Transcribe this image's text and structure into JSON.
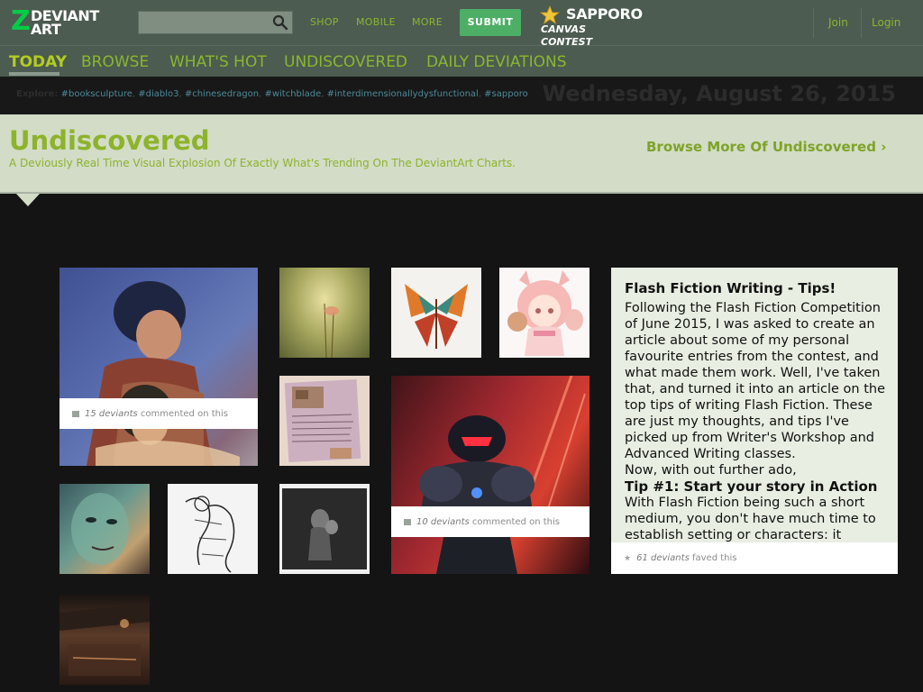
{
  "header": {
    "logo_mark": "Z",
    "logo_line1": "DEVIANT",
    "logo_line2": "ART",
    "search": {
      "value": "",
      "placeholder": ""
    },
    "nav": [
      "SHOP",
      "MOBILE",
      "MORE"
    ],
    "submit_label": "SUBMIT",
    "contest_line1": "SAPPORO",
    "contest_line2": "CANVAS CONTEST",
    "join_label": "Join",
    "login_label": "Login"
  },
  "tabs": [
    {
      "label": "TODAY",
      "active": true
    },
    {
      "label": "BROWSE",
      "active": false
    },
    {
      "label": "WHAT'S HOT",
      "active": false
    },
    {
      "label": "UNDISCOVERED",
      "active": false
    },
    {
      "label": "DAILY DEVIATIONS",
      "active": false
    }
  ],
  "explore": {
    "label": "Explore:",
    "tags": [
      "#booksculpture",
      "#diablo3",
      "#chinesedragon",
      "#witchblade",
      "#interdimensionallydysfunctional",
      "#sapporo"
    ]
  },
  "date": "Wednesday, August 26, 2015",
  "hero": {
    "title": "Undiscovered",
    "subtitle": "A Deviously Real Time Visual Explosion Of Exactly What's Trending On The DeviantArt Charts.",
    "browse_more": "Browse More Of Undiscovered",
    "browse_arrow": "›"
  },
  "tiles": [
    {
      "id": "figure-couple",
      "comment_count": "15 deviants",
      "comment_suffix": "commented on this"
    },
    {
      "id": "armored-robot",
      "comment_count": "10 deviants",
      "comment_suffix": "commented on this"
    }
  ],
  "article": {
    "title": "Flash Fiction Writing - Tips!",
    "para1": "Following the Flash Fiction Competition of June 2015, I was asked to create an article about some of my personal favourite entries from the contest, and what made them work. Well, I've taken that, and turned it into an article on the top tips of writing Flash Fiction. These are just my thoughts, and tips I've picked up from Writer's Workshop and Advanced Writing classes.",
    "para2": "Now, with out further ado,",
    "tip": "Tip #1: Start your story in Action",
    "para3": "With Flash Fiction being such a short medium, you don't have much time to establish setting or characters: it",
    "fav_count": "61 deviants",
    "fav_suffix": "faved this"
  },
  "colors": {
    "topbar": "#4c5c50",
    "accent_green": "#8ab630",
    "submit_green": "#4dae66",
    "hero_bg": "#d2dcc7",
    "page_bg": "#141414"
  }
}
